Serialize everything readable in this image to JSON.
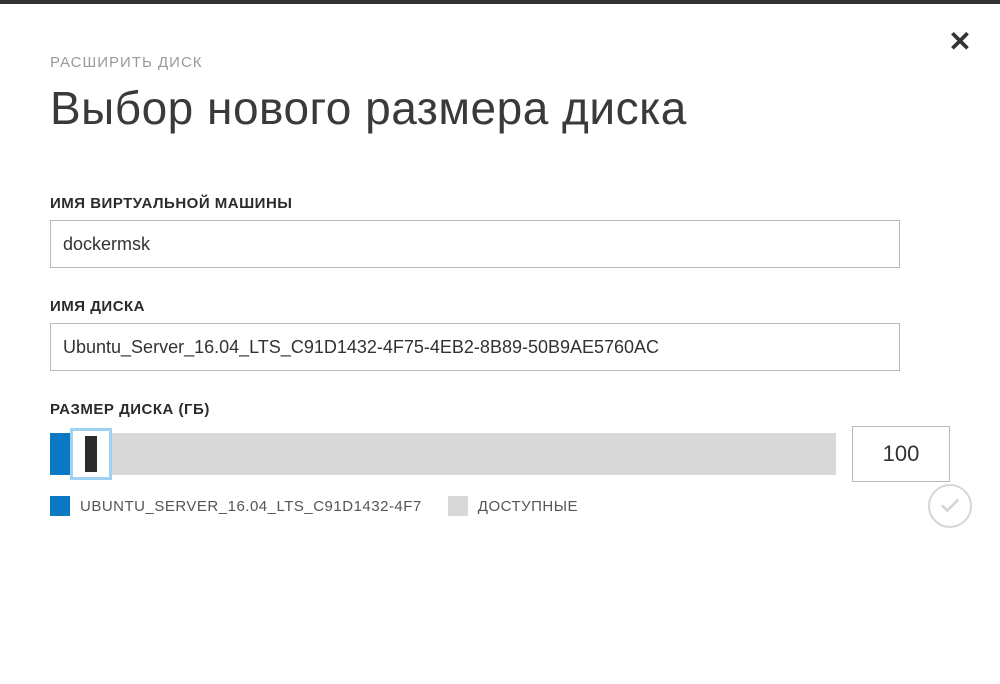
{
  "breadcrumb": "РАСШИРИТЬ ДИСК",
  "title": "Выбор нового размера диска",
  "fields": {
    "vm_name_label": "ИМЯ ВИРТУАЛЬНОЙ МАШИНЫ",
    "vm_name_value": "dockermsk",
    "disk_name_label": "ИМЯ ДИСКА",
    "disk_name_value": "Ubuntu_Server_16.04_LTS_C91D1432-4F75-4EB2-8B89-50B9AE5760AC",
    "disk_size_label": "РАЗМЕР ДИСКА (ГБ)",
    "disk_size_value": "100"
  },
  "legend": {
    "used_label": "UBUNTU_SERVER_16.04_LTS_C91D1432-4F7",
    "available_label": "ДОСТУПНЫЕ"
  }
}
